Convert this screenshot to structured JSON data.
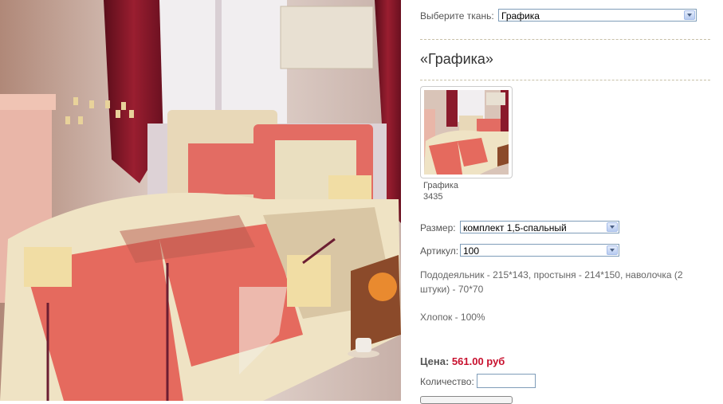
{
  "fabric_select": {
    "label": "Выберите ткань:",
    "value": "Графика"
  },
  "product": {
    "title": "«Графика»",
    "thumbnail": {
      "name": "Графика",
      "code": "3435"
    }
  },
  "size_select": {
    "label": "Размер:",
    "value": "комплект 1,5-спальный"
  },
  "article_select": {
    "label": "Артикул:",
    "value": "100"
  },
  "description": "Пододеяльник - 215*143, простыня - 214*150, наволочка (2 штуки) - 70*70",
  "material": "Хлопок - 100%",
  "price": {
    "label": "Цена:",
    "value": "561.00 руб"
  },
  "quantity": {
    "label": "Количество:",
    "value": ""
  },
  "colors": {
    "price": "#c8102e",
    "select_border": "#7f9db9",
    "divider": "#c8c0a8"
  }
}
